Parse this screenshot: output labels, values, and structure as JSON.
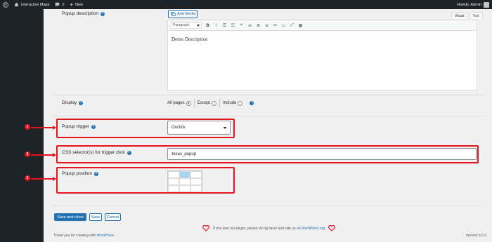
{
  "adminbar": {
    "site_name": "Interactive Maps",
    "comments_count": "0",
    "new_label": "New",
    "greeting": "Howdy, Admin"
  },
  "fields": {
    "description_label": "Popup description",
    "add_media_label": "Add Media",
    "tab_visual": "Visual",
    "tab_text": "Text",
    "paragraph_format": "Paragraph",
    "editor_content": "Demo Description",
    "display_label": "Display",
    "display_options": [
      "All pages",
      "Except",
      "Include"
    ],
    "display_selected": "All pages",
    "trigger_label": "Popup trigger",
    "trigger_value": "Onclick",
    "selector_label": "CSS selector(s) for trigger click",
    "selector_value": ".texas_popup",
    "position_label": "Popup position",
    "position_selected": "top-center"
  },
  "annotations": [
    "1",
    "2",
    "3"
  ],
  "buttons": {
    "save_close": "Save and close",
    "save": "Save",
    "cancel": "Cancel"
  },
  "footer": {
    "thanks_prefix": "Thank you for creating with",
    "wordpress_link": "WordPress",
    "love_prefix": "If you love our plugin, please do big favor and rate us on",
    "wporg_link": "WordPress.org",
    "version": "Version 6.0.3"
  },
  "colors": {
    "accent": "#2271b1",
    "highlight": "#e1161e",
    "adminbar": "#1d2327"
  }
}
